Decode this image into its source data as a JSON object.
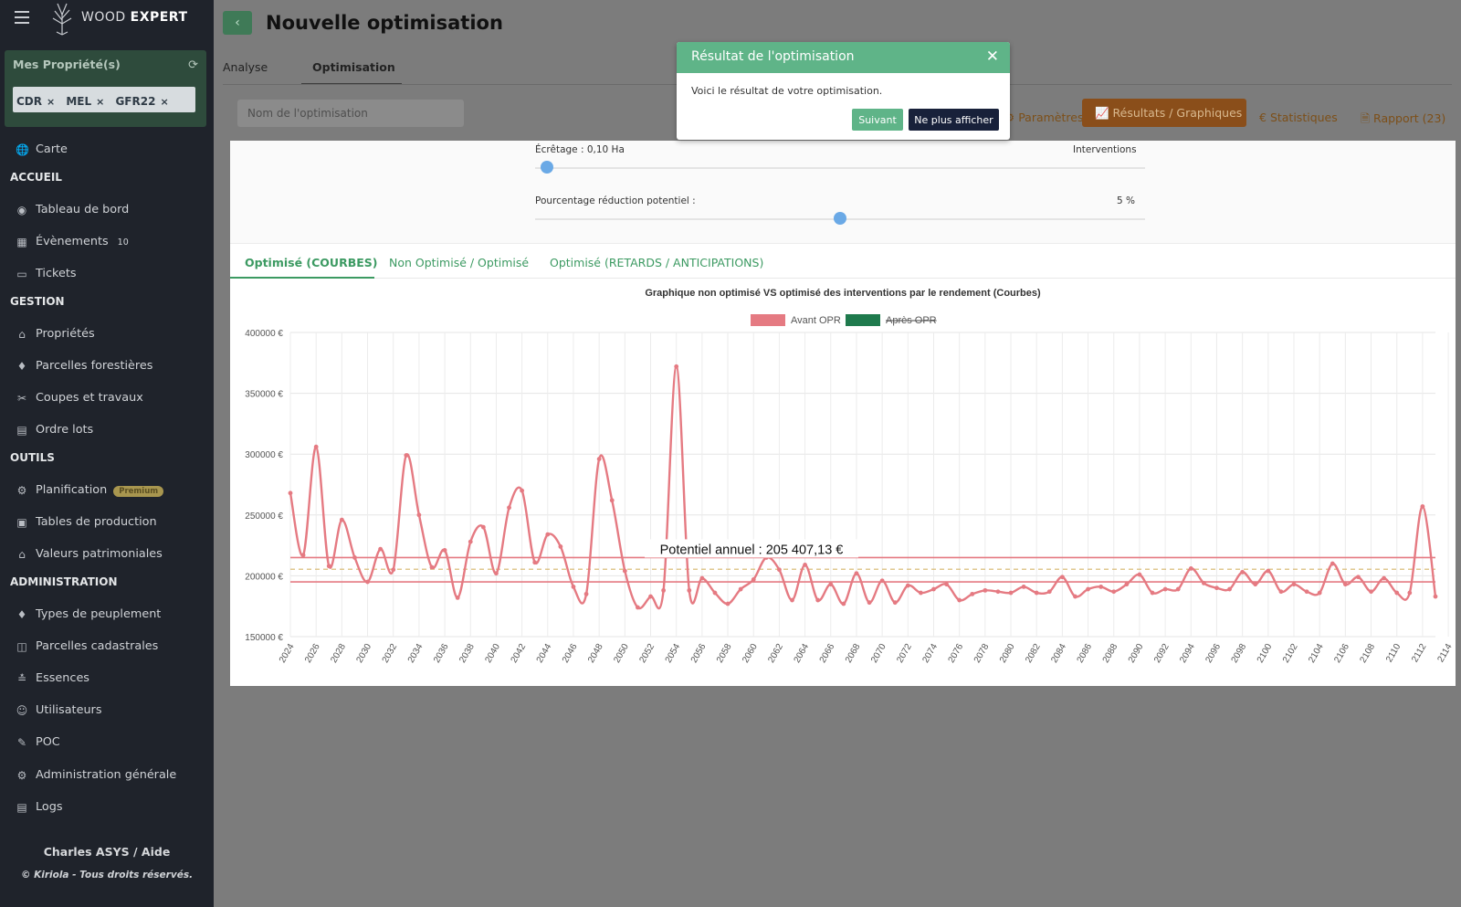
{
  "brand": {
    "name_light": "WOOD ",
    "name_bold": "EXPERT"
  },
  "sidebar": {
    "properties_title": "Mes Propriété(s)",
    "tags": [
      "CDR",
      "MEL",
      "GFR22"
    ],
    "items": [
      {
        "label": "Carte",
        "icon": "globe-icon",
        "glyph": "🌐"
      },
      {
        "label": "Tableau de bord",
        "icon": "dashboard-icon",
        "glyph": "◉"
      },
      {
        "label": "Évènements",
        "icon": "calendar-icon",
        "glyph": "▦",
        "count": "10"
      },
      {
        "label": "Tickets",
        "icon": "ticket-icon",
        "glyph": "▭"
      },
      {
        "label": "Propriétés",
        "icon": "home-icon",
        "glyph": "⌂"
      },
      {
        "label": "Parcelles forestières",
        "icon": "bell-icon",
        "glyph": "♦"
      },
      {
        "label": "Coupes et travaux",
        "icon": "tools-icon",
        "glyph": "✂"
      },
      {
        "label": "Ordre lots",
        "icon": "file-icon",
        "glyph": "▤"
      },
      {
        "label": "Planification",
        "icon": "gear-icon",
        "glyph": "⚙",
        "badge": "Premium"
      },
      {
        "label": "Tables de production",
        "icon": "briefcase-icon",
        "glyph": "▣"
      },
      {
        "label": "Valeurs patrimoniales",
        "icon": "bank-icon",
        "glyph": "⌂"
      },
      {
        "label": "Types de peuplement",
        "icon": "bell-icon",
        "glyph": "♦"
      },
      {
        "label": "Parcelles cadastrales",
        "icon": "map-icon",
        "glyph": "◫"
      },
      {
        "label": "Essences",
        "icon": "leaf-icon",
        "glyph": "≛"
      },
      {
        "label": "Utilisateurs",
        "icon": "users-icon",
        "glyph": "☺"
      },
      {
        "label": "POC",
        "icon": "pencil-icon",
        "glyph": "✎"
      },
      {
        "label": "Administration générale",
        "icon": "cogs-icon",
        "glyph": "⚙"
      },
      {
        "label": "Logs",
        "icon": "file-icon",
        "glyph": "▤"
      }
    ],
    "sections": [
      "ACCUEIL",
      "GESTION",
      "OUTILS",
      "ADMINISTRATION"
    ],
    "footer_user": "Charles ASYS  /  Aide",
    "footer_copy": "© Kiriola - Tous droits réservés."
  },
  "header": {
    "title": "Nouvelle optimisation"
  },
  "tabs": [
    {
      "label": "Analyse"
    },
    {
      "label": "Optimisation"
    }
  ],
  "name_input": {
    "placeholder": "Nom de l'optimisation"
  },
  "subnav": {
    "parametres": "Paramètres",
    "resultats": "Résultats / Graphiques",
    "statistiques": "Statistiques",
    "rapport": "Rapport (23)"
  },
  "sliders": {
    "ecretage_label": "Écrêtage : 0,10 Ha",
    "interventions_label": "Interventions",
    "pourcentage_label": "Pourcentage réduction potentiel :",
    "pourcentage_value": "5 %",
    "ecretage_fraction": 0.02,
    "pourcentage_fraction": 0.5
  },
  "chart_tabs": [
    {
      "label": "Optimisé (COURBES)"
    },
    {
      "label": "Non Optimisé / Optimisé"
    },
    {
      "label": "Optimisé (RETARDS / ANTICIPATIONS)"
    }
  ],
  "modal": {
    "title": "Résultat de l'optimisation",
    "body": "Voici le résultat de votre optimisation.",
    "next_label": "Suivant",
    "never_label": "Ne plus afficher"
  },
  "colors": {
    "avant": "#e57a82",
    "apres": "#1f7a4d",
    "accent": "#3c9a62"
  },
  "chart_data": {
    "type": "line",
    "title": "Graphique non optimisé VS optimisé des interventions par le rendement (Courbes)",
    "legend": [
      "Avant OPR",
      "Après OPR"
    ],
    "annotation": "Potentiel annuel : 205 407,13 €",
    "ylim": [
      150000,
      400000
    ],
    "yticks": [
      "150000 €",
      "200000 €",
      "250000 €",
      "300000 €",
      "350000 €",
      "400000 €"
    ],
    "x_start": 2024,
    "x_end": 2114,
    "x_step_labels": 2,
    "reference_lines": {
      "upper": 215000,
      "mean": 205407.13,
      "lower": 195000
    },
    "series": [
      {
        "name": "Avant OPR",
        "values": [
          268000,
          217000,
          306000,
          208000,
          246000,
          215000,
          195000,
          222000,
          205000,
          299000,
          250000,
          207000,
          221000,
          182000,
          228000,
          240000,
          202000,
          256000,
          270000,
          211000,
          234000,
          224000,
          191000,
          185000,
          296000,
          262000,
          204000,
          174000,
          183000,
          188000,
          372000,
          188000,
          198000,
          186000,
          177000,
          189000,
          197000,
          215000,
          205000,
          180000,
          209000,
          180000,
          193000,
          177000,
          202000,
          178000,
          196000,
          178000,
          192000,
          186000,
          189000,
          193000,
          180000,
          185000,
          188000,
          187000,
          186000,
          191000,
          186000,
          187000,
          199000,
          183000,
          189000,
          191000,
          187000,
          193000,
          201000,
          186000,
          189000,
          189000,
          206000,
          194000,
          190000,
          189000,
          203000,
          193000,
          204000,
          187000,
          193000,
          187000,
          186000,
          210000,
          193000,
          199000,
          187000,
          198000,
          186000,
          186000,
          257000,
          183000
        ]
      }
    ]
  }
}
